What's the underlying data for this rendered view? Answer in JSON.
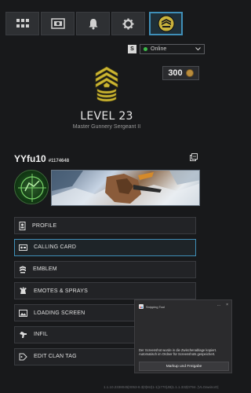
{
  "nav_tabs": [
    {
      "icon": "grid-icon"
    },
    {
      "icon": "store-icon"
    },
    {
      "icon": "bell-icon"
    },
    {
      "icon": "gear-icon"
    },
    {
      "icon": "profile-rank-icon",
      "active": true
    }
  ],
  "status": {
    "badge": "S",
    "value": "Online"
  },
  "currency": {
    "amount": "300"
  },
  "rank": {
    "level": "LEVEL 23",
    "title": "Master Gunnery Sergeant II"
  },
  "player": {
    "name": "YYfu10",
    "tag": "#1174648"
  },
  "menu": [
    {
      "label": "PROFILE",
      "icon": "profile-icon"
    },
    {
      "label": "CALLING CARD",
      "icon": "calling-card-icon",
      "active": true
    },
    {
      "label": "EMBLEM",
      "icon": "emblem-icon"
    },
    {
      "label": "EMOTES & SPRAYS",
      "icon": "emotes-icon"
    },
    {
      "label": "LOADING SCREEN",
      "icon": "loading-screen-icon"
    },
    {
      "label": "INFIL",
      "icon": "infil-icon"
    },
    {
      "label": "EDIT CLAN TAG",
      "icon": "clan-tag-icon"
    }
  ],
  "toast": {
    "app": "Snipping Tool",
    "dots": "...",
    "close": "×",
    "message": "Der Screenshot wurde in die Zwischenablage kopiert. Automatisch im Ordner für Screenshots gespeichert.",
    "button": "Markup und Freigabe"
  },
  "footer_code": "1.1.10.2338045|0053-8.3|0|MJ|1-1|1770|JB|1.1.1.332|0794. |VLOawinoO|"
}
